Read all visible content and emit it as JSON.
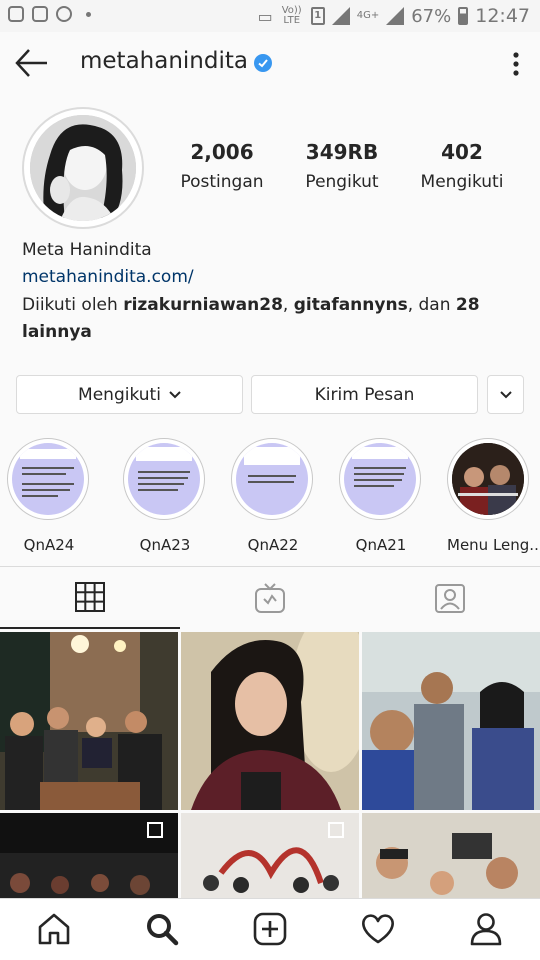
{
  "status_bar": {
    "volte": "Vo)) LTE",
    "sim": "1",
    "network": "4G+",
    "battery": "67%",
    "time": "12:47"
  },
  "header": {
    "username": "metahanindita",
    "back_icon": "back-arrow-icon",
    "verified_icon": "verified-badge-icon",
    "more_icon": "more-vertical-icon"
  },
  "stats": [
    {
      "value": "2,006",
      "label": "Postingan"
    },
    {
      "value": "349RB",
      "label": "Pengikut"
    },
    {
      "value": "402",
      "label": "Mengikuti"
    }
  ],
  "bio": {
    "name": "Meta Hanindita",
    "link": "metahanindita.com/",
    "followed_prefix": "Diikuti oleh ",
    "followed_user1": "rizakurniawan28",
    "followed_sep1": ", ",
    "followed_user2": "gitafannyns",
    "followed_sep2": ", dan ",
    "followed_others": "28 lainnya"
  },
  "buttons": {
    "following": "Mengikuti",
    "message": "Kirim Pesan"
  },
  "highlights": [
    {
      "label": "QnA24"
    },
    {
      "label": "QnA23"
    },
    {
      "label": "QnA22"
    },
    {
      "label": "QnA21"
    },
    {
      "label": "Menu Leng..."
    }
  ],
  "tabs": [
    "grid-icon",
    "igtv-icon",
    "tagged-icon"
  ],
  "bottom_nav": [
    "home-icon",
    "search-icon",
    "add-post-icon",
    "heart-icon",
    "profile-icon"
  ],
  "colors": {
    "link": "#003569",
    "verified": "#3897f0",
    "highlight_bg": "#c9c7f4",
    "border": "#dbdbdb"
  }
}
